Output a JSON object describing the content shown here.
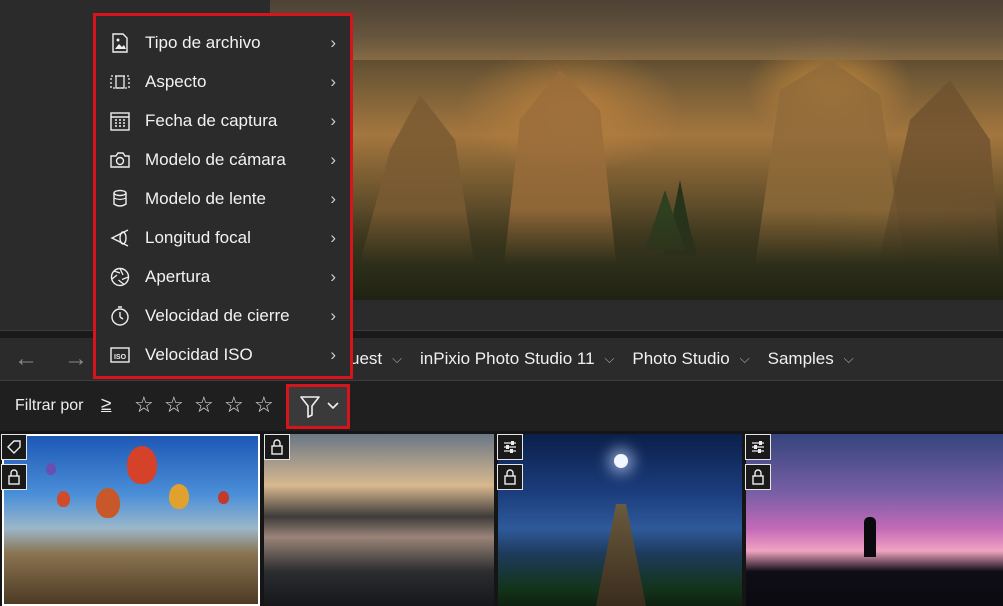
{
  "menu": {
    "items": [
      {
        "label": "Tipo de archivo",
        "icon": "image-file-icon"
      },
      {
        "label": "Aspecto",
        "icon": "aspect-ratio-icon"
      },
      {
        "label": "Fecha de captura",
        "icon": "calendar-icon"
      },
      {
        "label": "Modelo de cámara",
        "icon": "camera-icon"
      },
      {
        "label": "Modelo de lente",
        "icon": "lens-icon"
      },
      {
        "label": "Longitud focal",
        "icon": "focal-length-icon"
      },
      {
        "label": "Apertura",
        "icon": "aperture-icon"
      },
      {
        "label": "Velocidad de cierre",
        "icon": "shutter-timer-icon"
      },
      {
        "label": "Velocidad ISO",
        "icon": "iso-icon"
      }
    ],
    "submenu_glyph": "›"
  },
  "breadcrumb": {
    "back_glyph": "←",
    "forward_glyph": "→",
    "items": [
      "uest",
      "inPixio Photo Studio 11",
      "Photo Studio",
      "Samples"
    ],
    "separator_glyph": "⌵"
  },
  "filter": {
    "label": "Filtrar por",
    "comparator": "≥",
    "stars": [
      "☆",
      "☆",
      "☆",
      "☆",
      "☆"
    ],
    "dropdown_glyph": "⌵"
  },
  "thumbnails": [
    {
      "name": "balloons",
      "badges": [
        "tag-icon",
        "lock-icon"
      ],
      "selected": true
    },
    {
      "name": "lake-sunset",
      "badges": [
        "lock-icon"
      ],
      "selected": false
    },
    {
      "name": "pier-night",
      "badges": [
        "adjustments-icon",
        "lock-icon"
      ],
      "selected": false
    },
    {
      "name": "photographer-sky",
      "badges": [
        "adjustments-icon",
        "lock-icon"
      ],
      "selected": false
    }
  ],
  "colors": {
    "highlight": "#d6141c",
    "panel": "#2b2b2b",
    "background": "#1c1c1c"
  }
}
